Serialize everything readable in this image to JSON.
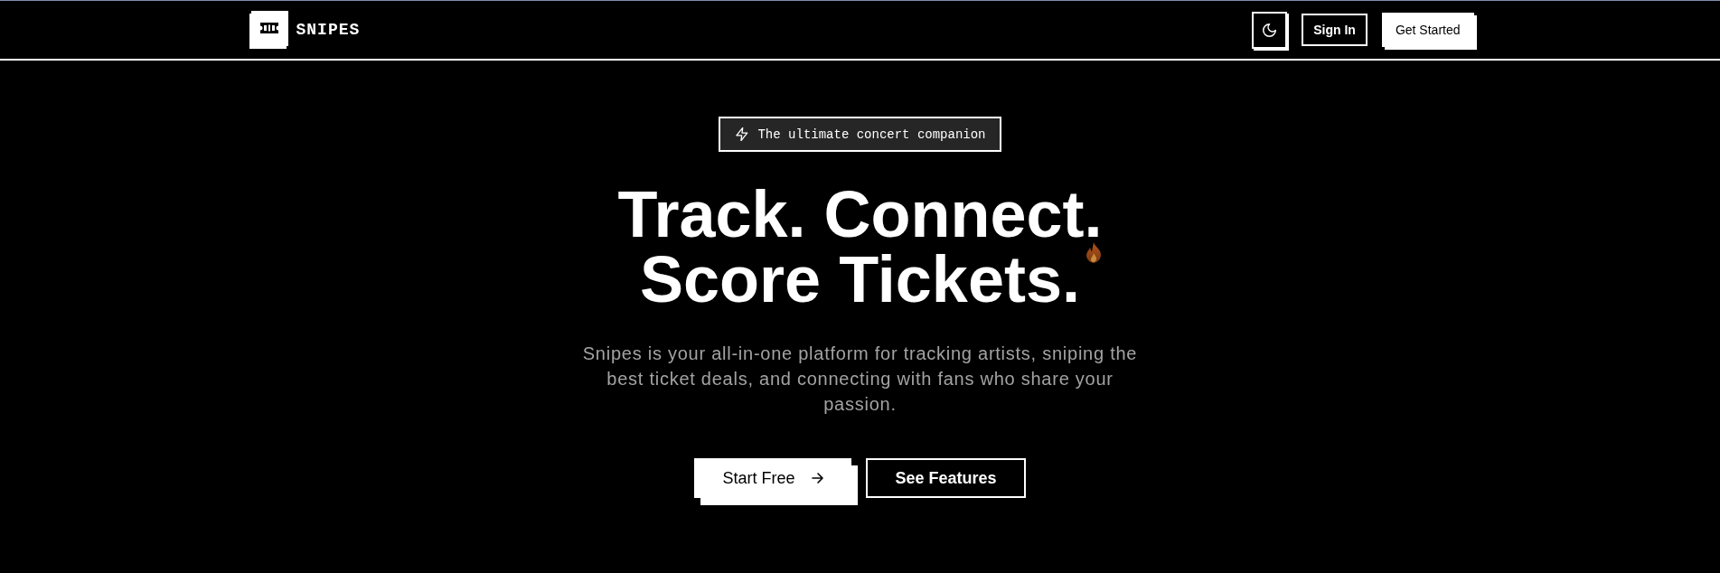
{
  "header": {
    "brand": "SNIPES",
    "buttons": [
      {
        "label": "Sign In",
        "kind": "outline"
      },
      {
        "label": "Get Started",
        "kind": "solid"
      }
    ]
  },
  "hero": {
    "badge": "The ultimate concert companion",
    "headline": [
      "Track. Connect.",
      "Score Tickets."
    ],
    "description": "Snipes is your all-in-one platform for tracking artists, sniping the best ticket deals, and connecting with fans who share your passion.",
    "buttons": [
      {
        "label": "Start Free",
        "kind": "primary"
      },
      {
        "label": "See Features",
        "kind": "secondary"
      }
    ]
  }
}
